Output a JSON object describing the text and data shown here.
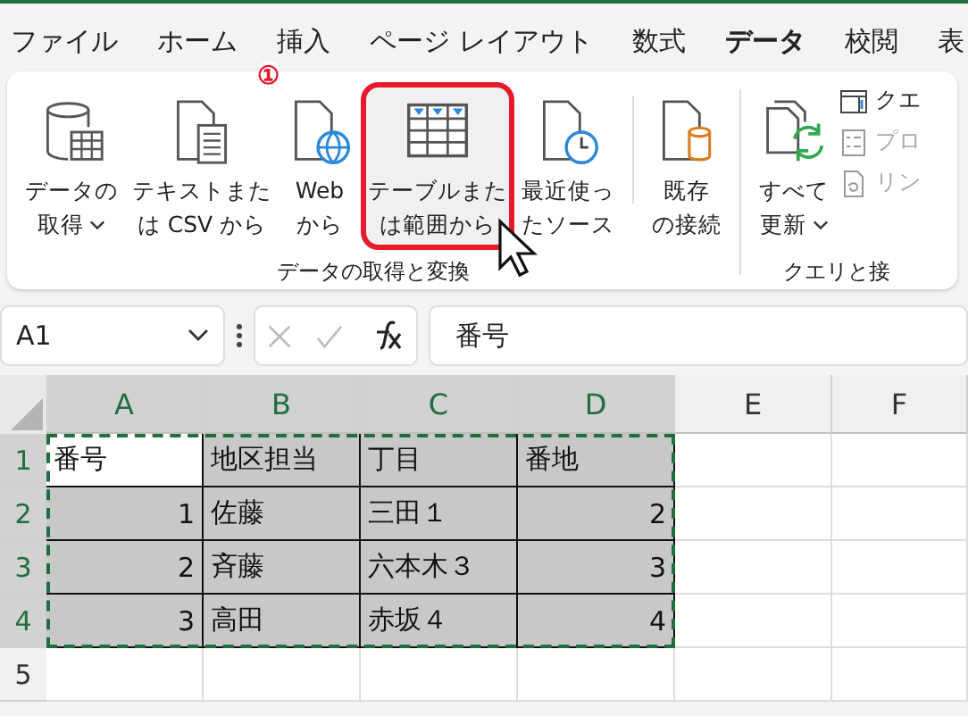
{
  "tabs": [
    {
      "label": "ファイル",
      "selected": false
    },
    {
      "label": "ホーム",
      "selected": false
    },
    {
      "label": "挿入",
      "selected": false
    },
    {
      "label": "ページ レイアウト",
      "selected": false
    },
    {
      "label": "数式",
      "selected": false
    },
    {
      "label": "データ",
      "selected": true
    },
    {
      "label": "校閲",
      "selected": false
    },
    {
      "label": "表",
      "selected": false
    }
  ],
  "ribbon": {
    "groups": [
      {
        "label": "データの取得と変換",
        "buttons": [
          {
            "kind": "database",
            "lines": [
              "データの",
              "取得"
            ],
            "dropdown": true,
            "highlighted": false
          },
          {
            "kind": "text-file",
            "lines": [
              "テキストまた",
              "は CSV から"
            ],
            "highlighted": false
          },
          {
            "kind": "web",
            "lines": [
              "Web",
              "から"
            ],
            "highlighted": false,
            "annotation": "①"
          },
          {
            "kind": "table",
            "lines": [
              "テーブルまた",
              "は範囲から"
            ],
            "highlighted": true
          },
          {
            "kind": "recent",
            "lines": [
              "最近使っ",
              "たソース"
            ],
            "highlighted": false
          },
          {
            "kind": "existing",
            "lines": [
              "既存",
              "の接続"
            ],
            "highlighted": false,
            "separator_before": true
          }
        ]
      },
      {
        "label": "クエリと接",
        "buttons": [
          {
            "kind": "refresh",
            "lines": [
              "すべて",
              "更新"
            ],
            "dropdown": true,
            "highlighted": false
          }
        ],
        "small_items": [
          {
            "kind": "query",
            "label": "クエ",
            "disabled": false
          },
          {
            "kind": "properties",
            "label": "プロ",
            "disabled": true
          },
          {
            "kind": "links",
            "label": "リン",
            "disabled": true
          }
        ]
      }
    ]
  },
  "formula_bar": {
    "name_box": "A1",
    "formula": "番号"
  },
  "sheet": {
    "columns": [
      {
        "label": "A",
        "selected": true
      },
      {
        "label": "B",
        "selected": true
      },
      {
        "label": "C",
        "selected": true
      },
      {
        "label": "D",
        "selected": true
      },
      {
        "label": "E",
        "selected": false
      },
      {
        "label": "F",
        "selected": false
      }
    ],
    "rows": [
      {
        "label": "1",
        "selected": true,
        "cells": [
          {
            "text": "番号",
            "kind": "text",
            "selected": false
          },
          {
            "text": "地区担当",
            "kind": "text",
            "selected": true
          },
          {
            "text": "丁目",
            "kind": "text",
            "selected": true
          },
          {
            "text": "番地",
            "kind": "text",
            "selected": true
          }
        ]
      },
      {
        "label": "2",
        "selected": true,
        "cells": [
          {
            "text": "1",
            "kind": "number",
            "selected": true
          },
          {
            "text": "佐藤",
            "kind": "text",
            "selected": true
          },
          {
            "text": "三田１",
            "kind": "text",
            "selected": true
          },
          {
            "text": "2",
            "kind": "number",
            "selected": true
          }
        ]
      },
      {
        "label": "3",
        "selected": true,
        "cells": [
          {
            "text": "2",
            "kind": "number",
            "selected": true
          },
          {
            "text": "斉藤",
            "kind": "text",
            "selected": true
          },
          {
            "text": "六本木３",
            "kind": "text",
            "selected": true
          },
          {
            "text": "3",
            "kind": "number",
            "selected": true
          }
        ]
      },
      {
        "label": "4",
        "selected": true,
        "cells": [
          {
            "text": "3",
            "kind": "number",
            "selected": true
          },
          {
            "text": "高田",
            "kind": "text",
            "selected": true
          },
          {
            "text": "赤坂４",
            "kind": "text",
            "selected": true
          },
          {
            "text": "4",
            "kind": "number",
            "selected": true
          }
        ]
      },
      {
        "label": "5",
        "selected": false
      }
    ],
    "copy_marquee": true
  }
}
